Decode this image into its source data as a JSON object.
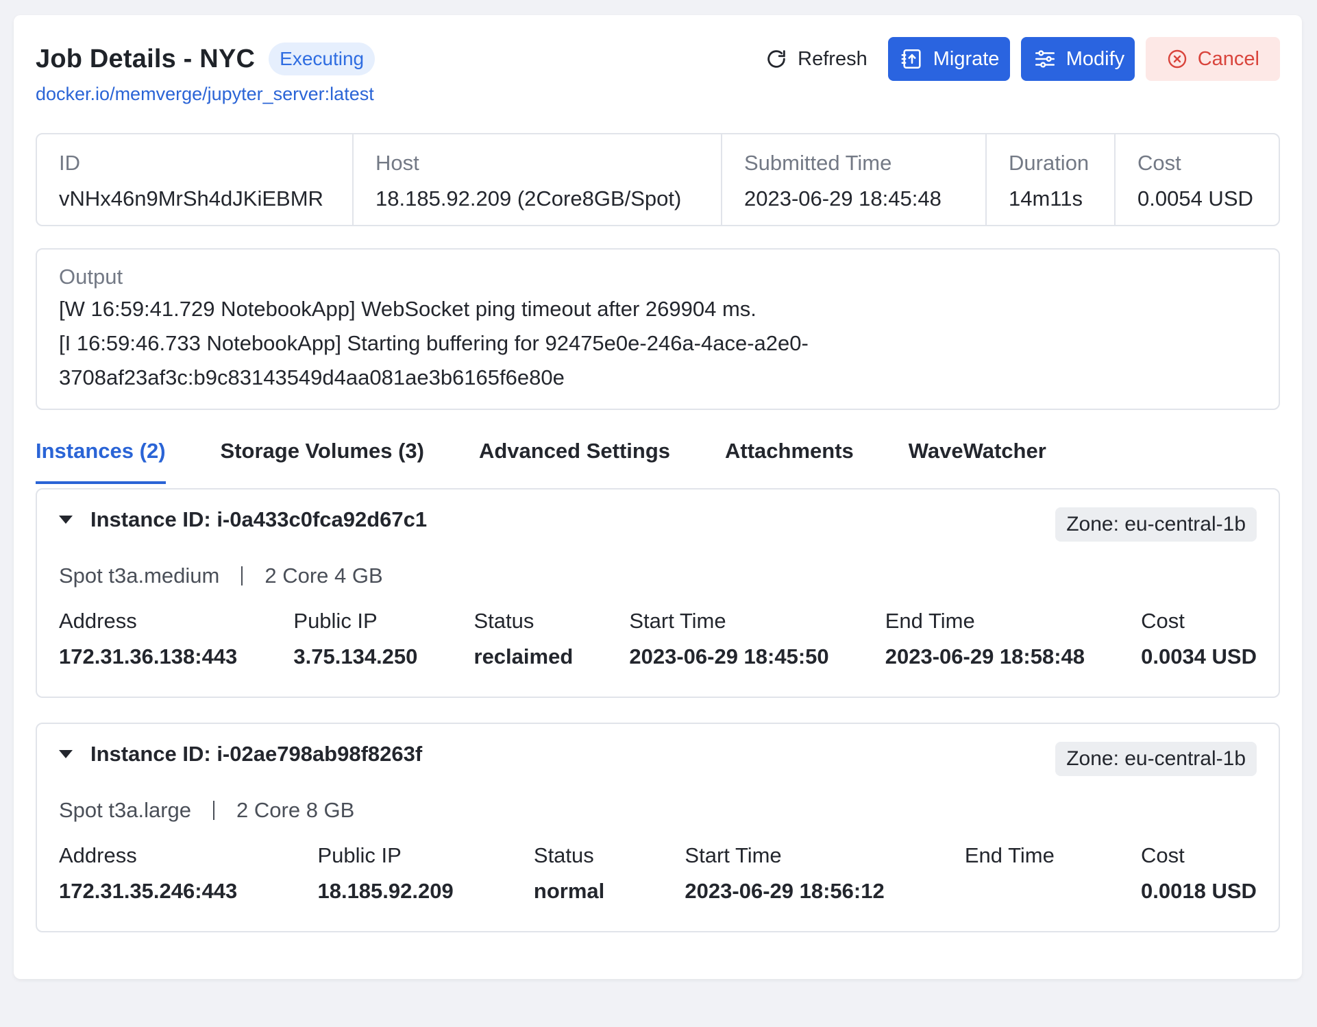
{
  "header": {
    "title": "Job Details - NYC",
    "status": "Executing",
    "image": "docker.io/memverge/jupyter_server:latest",
    "actions": {
      "refresh": "Refresh",
      "migrate": "Migrate",
      "modify": "Modify",
      "cancel": "Cancel"
    }
  },
  "summary": {
    "id_label": "ID",
    "id": "vNHx46n9MrSh4dJKiEBMR",
    "host_label": "Host",
    "host": "18.185.92.209 (2Core8GB/Spot)",
    "submitted_label": "Submitted Time",
    "submitted": "2023-06-29 18:45:48",
    "duration_label": "Duration",
    "duration": "14m11s",
    "cost_label": "Cost",
    "cost": "0.0054 USD"
  },
  "output": {
    "label": "Output",
    "line1": "[W 16:59:41.729 NotebookApp] WebSocket ping timeout after 269904 ms.",
    "line2": "[I 16:59:46.733 NotebookApp] Starting buffering for 92475e0e-246a-4ace-a2e0-",
    "line3": "3708af23af3c:b9c83143549d4aa081ae3b6165f6e80e"
  },
  "tabs": [
    "Instances (2)",
    "Storage Volumes (3)",
    "Advanced Settings",
    "Attachments",
    "WaveWatcher"
  ],
  "field_labels": {
    "address": "Address",
    "public_ip": "Public IP",
    "status": "Status",
    "start_time": "Start Time",
    "end_time": "End Time",
    "cost": "Cost"
  },
  "instances": [
    {
      "title": "Instance ID: i-0a433c0fca92d67c1",
      "zone": "Zone: eu-central-1b",
      "type": "Spot t3a.medium",
      "spec": "2 Core 4 GB",
      "address": "172.31.36.138:443",
      "public_ip": "3.75.134.250",
      "status": "reclaimed",
      "start_time": "2023-06-29 18:45:50",
      "end_time": "2023-06-29 18:58:48",
      "cost": "0.0034 USD"
    },
    {
      "title": "Instance ID: i-02ae798ab98f8263f",
      "zone": "Zone: eu-central-1b",
      "type": "Spot t3a.large",
      "spec": "2 Core 8 GB",
      "address": "172.31.35.246:443",
      "public_ip": "18.185.92.209",
      "status": "normal",
      "start_time": "2023-06-29 18:56:12",
      "end_time": "",
      "cost": "0.0018 USD"
    }
  ],
  "icons": {
    "refresh": "refresh-icon",
    "migrate": "migrate-icon",
    "modify": "sliders-icon",
    "cancel": "close-circle-icon",
    "caret": "caret-down-icon"
  },
  "colors": {
    "primary": "#2a64e0",
    "link": "#2a64d6",
    "danger": "#d9443c",
    "danger_bg": "#fde8e6",
    "badge_bg": "#e6effd"
  }
}
